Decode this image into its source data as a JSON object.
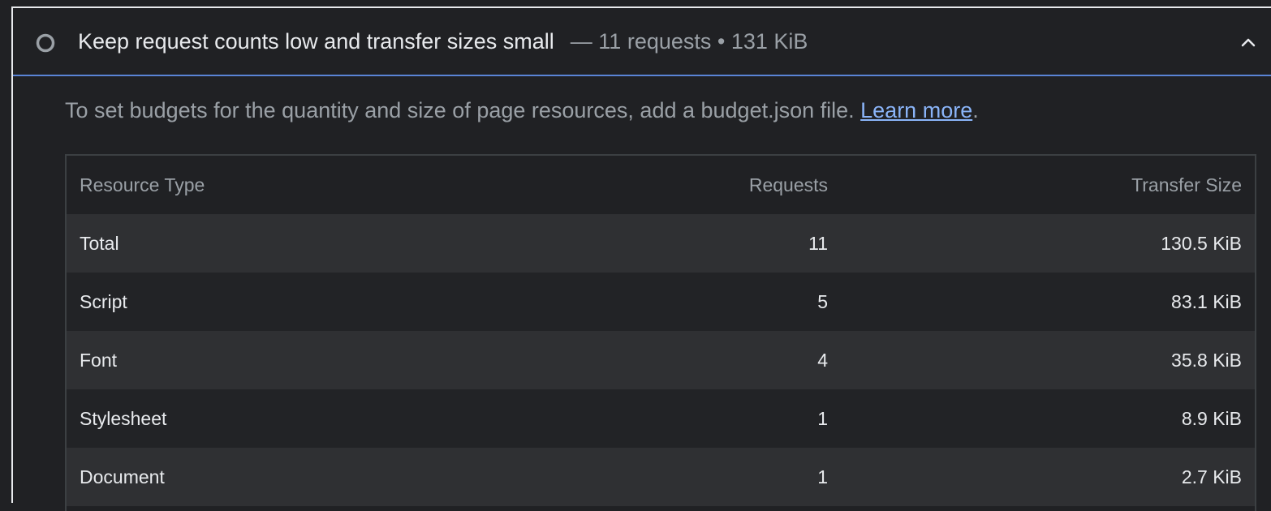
{
  "audit": {
    "title": "Keep request counts low and transfer sizes small",
    "summary": "— 11 requests • 131 KiB",
    "status_icon": "circle-outline-icon",
    "toggle_icon": "chevron-up-icon",
    "description_text": "To set budgets for the quantity and size of page resources, add a budget.json file. ",
    "learn_more_label": "Learn more",
    "description_end": "."
  },
  "colors": {
    "background": "#202124",
    "header_divider": "#5a84d6",
    "link": "#8ab4f8",
    "row_odd": "#2f3033",
    "row_even": "#222326"
  },
  "table": {
    "headers": {
      "type": "Resource Type",
      "requests": "Requests",
      "size": "Transfer Size"
    },
    "rows": [
      {
        "type": "Total",
        "requests": "11",
        "size": "130.5 KiB"
      },
      {
        "type": "Script",
        "requests": "5",
        "size": "83.1 KiB"
      },
      {
        "type": "Font",
        "requests": "4",
        "size": "35.8 KiB"
      },
      {
        "type": "Stylesheet",
        "requests": "1",
        "size": "8.9 KiB"
      },
      {
        "type": "Document",
        "requests": "1",
        "size": "2.7 KiB"
      }
    ]
  }
}
